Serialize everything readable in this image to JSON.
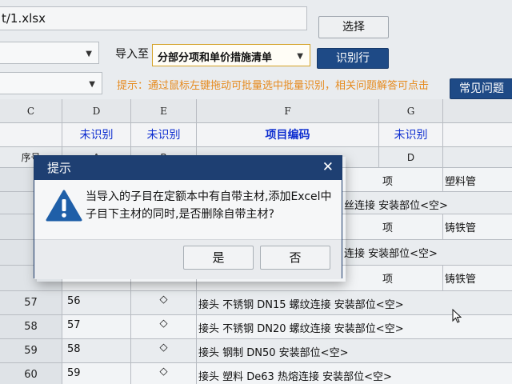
{
  "top": {
    "file_path": "t/1.xlsx",
    "select_button": "选择",
    "import_label": "导入至",
    "import_target": "分部分项和单价措施清单",
    "recognize_button": "识别行",
    "hint": "提示：通过鼠标左键拖动可批量选中批量识别，相关问题解答可点击",
    "faq_button": "常见问题"
  },
  "sheet": {
    "columns": [
      "C",
      "D",
      "E",
      "F",
      "G"
    ],
    "subheaders": {
      "D": "未识别",
      "E": "未识别",
      "F": "项目编码",
      "G": "未识别"
    },
    "row3": {
      "c": "序号",
      "d": "A",
      "e": "B",
      "g": "D"
    },
    "partial_rows": [
      {
        "unit": "项",
        "mat": "塑料管",
        "desc": "丝连接 安装部位<空>"
      },
      {
        "unit": "项",
        "mat": "铸铁管",
        "desc": "连接 安装部位<空>"
      },
      {
        "unit": "项",
        "mat": "铸铁管"
      }
    ],
    "rows": [
      {
        "rownum": "57",
        "seq": "56",
        "sym": "◇",
        "desc": "接头 不锈钢 DN15 螺纹连接 安装部位<空>"
      },
      {
        "rownum": "58",
        "seq": "57",
        "sym": "◇",
        "desc": "接头 不锈钢 DN20 螺纹连接 安装部位<空>"
      },
      {
        "rownum": "59",
        "seq": "58",
        "sym": "◇",
        "desc": "接头 钢制 DN50 安装部位<空>"
      },
      {
        "rownum": "60",
        "seq": "59",
        "sym": "◇",
        "desc": "接头 塑料 De63 热熔连接 安装部位<空>"
      }
    ]
  },
  "dialog": {
    "title": "提示",
    "message": "当导入的子目在定额本中有自带主材,添加Excel中子目下主材的同时,是否删除自带主材?",
    "yes_button": "是",
    "no_button": "否"
  },
  "colors": {
    "dialog_title_bg": "#1e3f72",
    "button_blue": "#1e4a86",
    "hint_orange": "#e68a1e",
    "header_blue_text": "#0f2fd0",
    "warning_blue": "#1f5fa8"
  }
}
